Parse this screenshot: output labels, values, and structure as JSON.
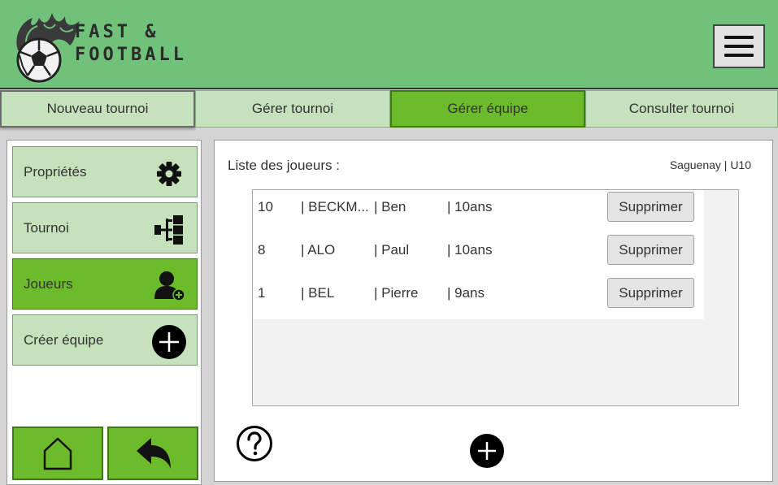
{
  "header": {
    "brand_line1": "FAST &",
    "brand_line2": "FOOTBALL",
    "logo_icon": "flaming-soccer-ball-icon",
    "menu_icon": "hamburger-menu-icon"
  },
  "tabs": [
    {
      "label": "Nouveau tournoi"
    },
    {
      "label": "Gérer tournoi"
    },
    {
      "label": "Gérer équipe",
      "active": true
    },
    {
      "label": "Consulter tournoi"
    }
  ],
  "sidebar": {
    "items": [
      {
        "label": "Propriétés",
        "icon": "gear-icon"
      },
      {
        "label": "Tournoi",
        "icon": "bracket-tree-icon"
      },
      {
        "label": "Joueurs",
        "icon": "add-user-icon",
        "active": true
      },
      {
        "label": "Créer équipe",
        "icon": "plus-circle-icon"
      }
    ],
    "home_icon": "home-icon",
    "back_icon": "back-arrow-icon"
  },
  "main": {
    "list_title": "Liste des joueurs :",
    "team_info": "Saguenay | U10",
    "players": [
      {
        "number": "10",
        "last_name": "| BECKM...",
        "first_name": "| Ben",
        "age": "| 10ans",
        "delete_label": "Supprimer"
      },
      {
        "number": "8",
        "last_name": "| ALO",
        "first_name": "| Paul",
        "age": "| 10ans",
        "delete_label": "Supprimer"
      },
      {
        "number": "1",
        "last_name": "| BEL",
        "first_name": "| Pierre",
        "age": "| 9ans",
        "delete_label": "Supprimer"
      }
    ],
    "help_icon": "help-question-icon",
    "add_icon": "add-player-icon"
  },
  "colors": {
    "header_green": "#70c27a",
    "active_green": "#6cbb2a",
    "light_green": "#c6e2bd"
  }
}
